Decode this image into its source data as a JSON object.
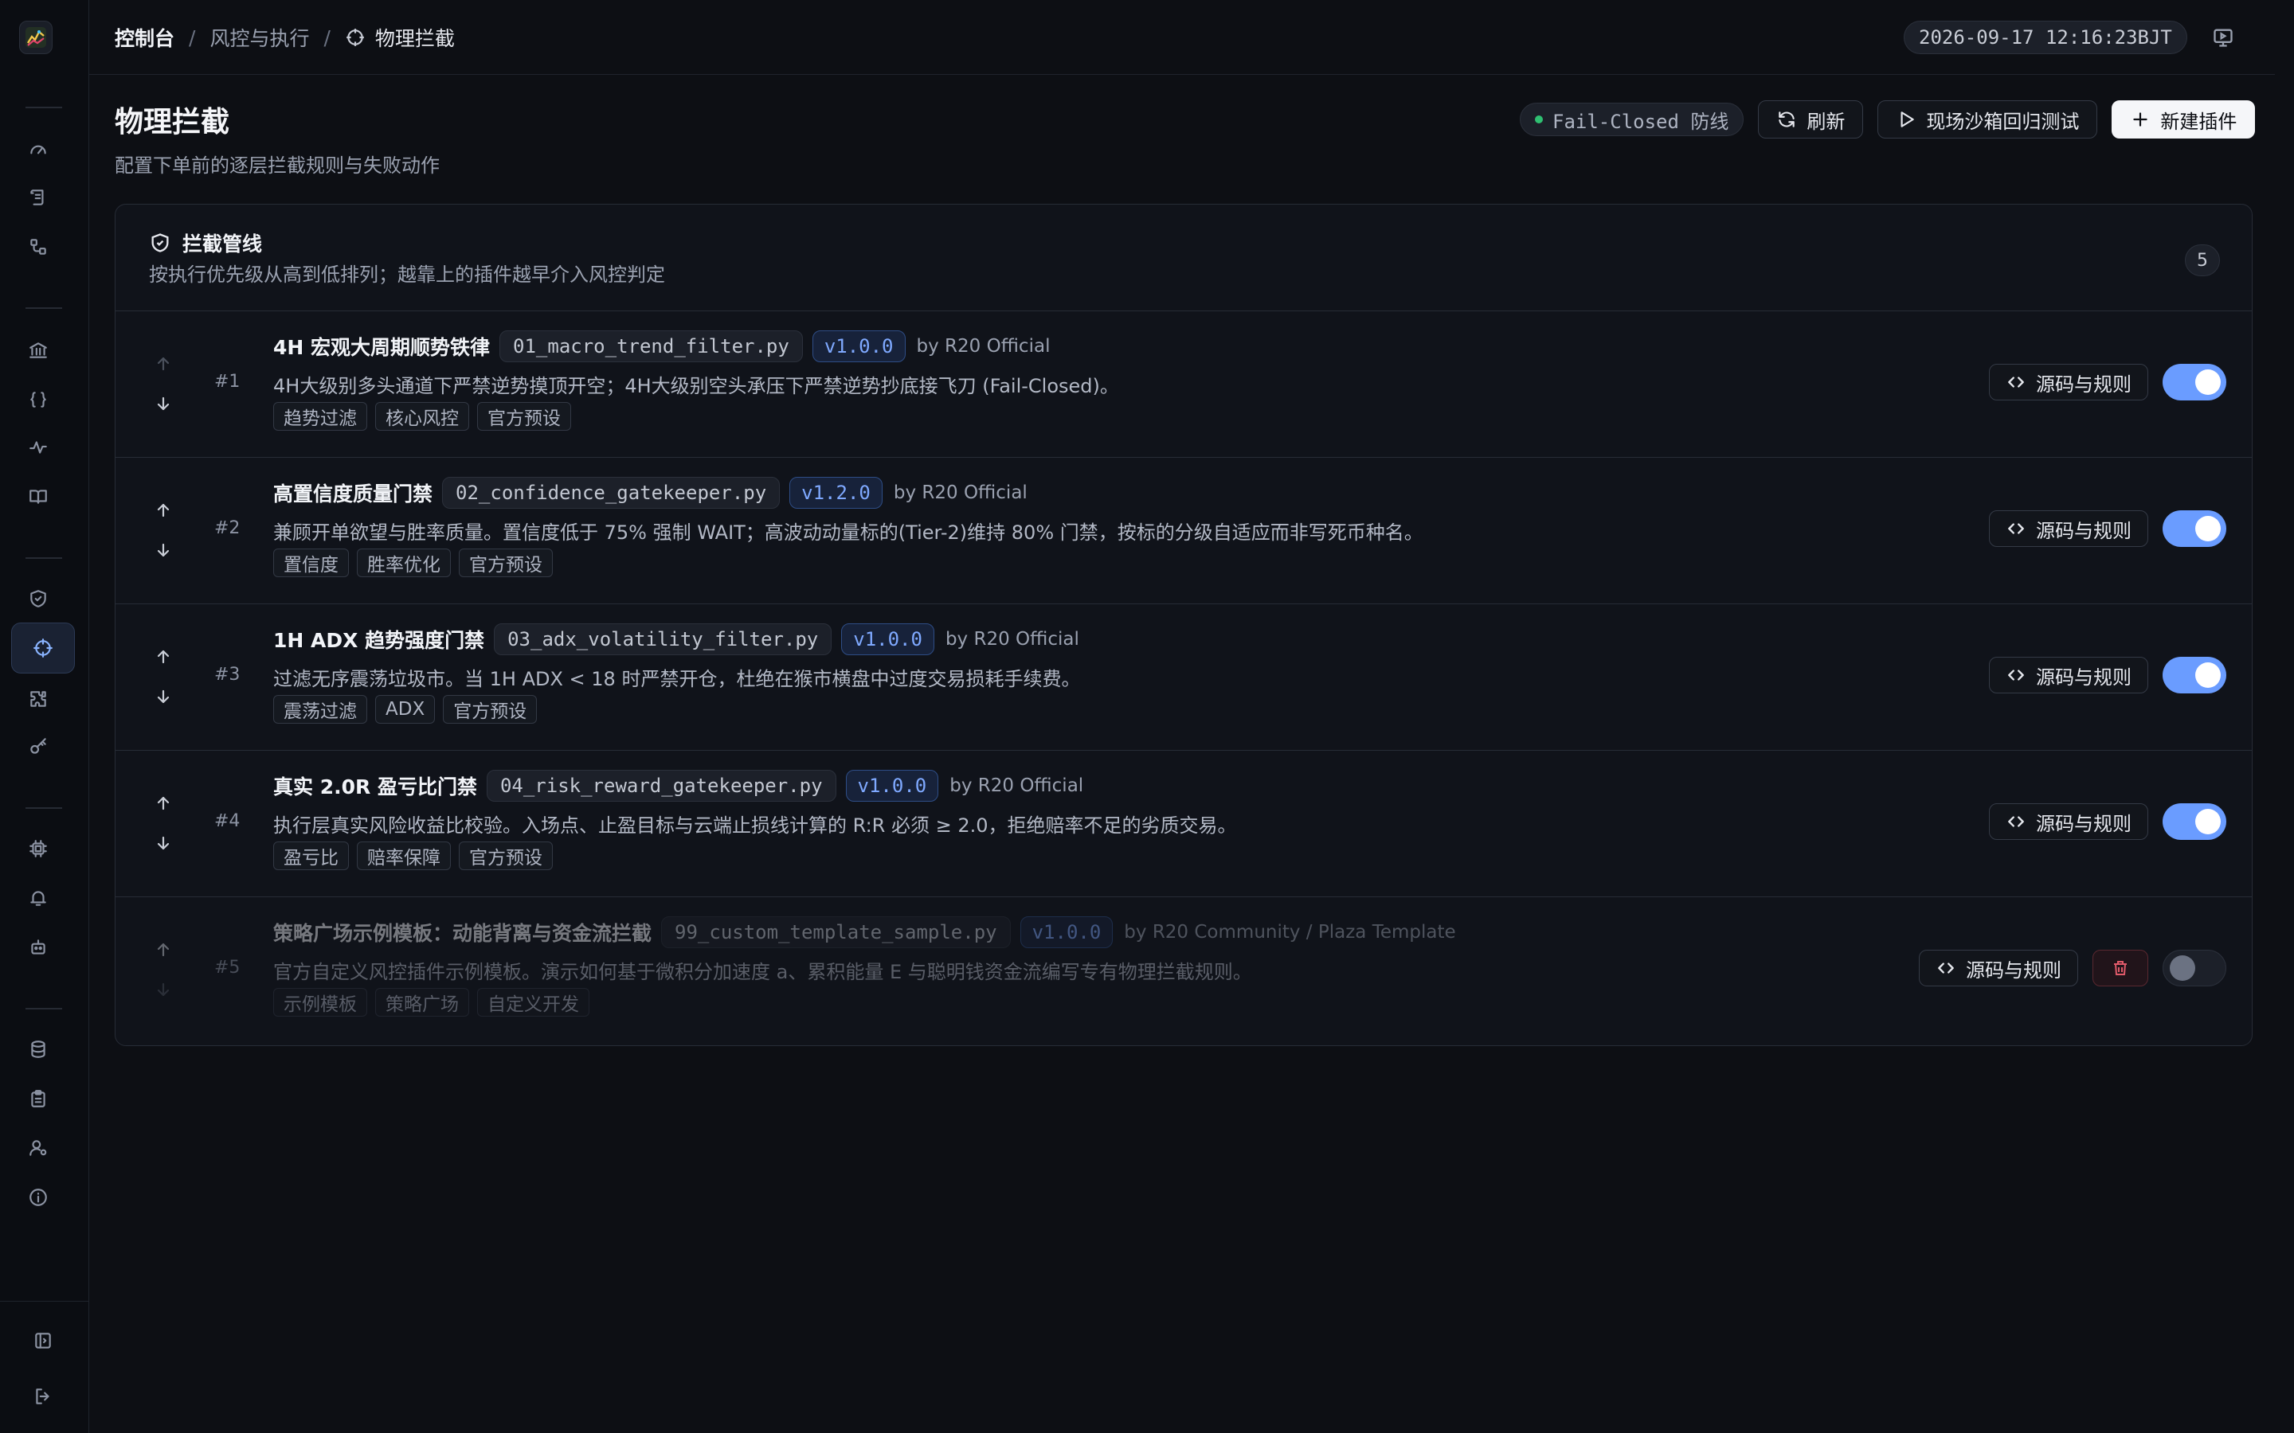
{
  "breadcrumb": {
    "root": "控制台",
    "section": "风控与执行",
    "current": "物理拦截"
  },
  "clock": "2026-09-17 12:16:23BJT",
  "page": {
    "title": "物理拦截",
    "subtitle": "配置下单前的逐层拦截规则与失败动作"
  },
  "actions": {
    "status_label": "Fail-Closed 防线",
    "refresh": "刷新",
    "sandbox": "现场沙箱回归测试",
    "new_plugin": "新建插件"
  },
  "pipeline": {
    "title": "拦截管线",
    "description": "按执行优先级从高到低排列；越靠上的插件越早介入风控判定",
    "count": "5",
    "source_button": "源码与规则",
    "plugins": [
      {
        "rank": "#1",
        "name": "4H 宏观大周期顺势铁律",
        "file": "01_macro_trend_filter.py",
        "version": "v1.0.0",
        "author": "by R20 Official",
        "description": "4H大级别多头通道下严禁逆势摸顶开空；4H大级别空头承压下严禁逆势抄底接飞刀 (Fail-Closed)。",
        "tags": [
          "趋势过滤",
          "核心风控",
          "官方预设"
        ],
        "enabled": true
      },
      {
        "rank": "#2",
        "name": "高置信度质量门禁",
        "file": "02_confidence_gatekeeper.py",
        "version": "v1.2.0",
        "author": "by R20 Official",
        "description": "兼顾开单欲望与胜率质量。置信度低于 75% 强制 WAIT；高波动动量标的(Tier-2)维持 80% 门禁，按标的分级自适应而非写死币种名。",
        "tags": [
          "置信度",
          "胜率优化",
          "官方预设"
        ],
        "enabled": true
      },
      {
        "rank": "#3",
        "name": "1H ADX 趋势强度门禁",
        "file": "03_adx_volatility_filter.py",
        "version": "v1.0.0",
        "author": "by R20 Official",
        "description": "过滤无序震荡垃圾市。当 1H ADX < 18 时严禁开仓，杜绝在猴市横盘中过度交易损耗手续费。",
        "tags": [
          "震荡过滤",
          "ADX",
          "官方预设"
        ],
        "enabled": true
      },
      {
        "rank": "#4",
        "name": "真实 2.0R 盈亏比门禁",
        "file": "04_risk_reward_gatekeeper.py",
        "version": "v1.0.0",
        "author": "by R20 Official",
        "description": "执行层真实风险收益比校验。入场点、止盈目标与云端止损线计算的 R:R 必须 ≥ 2.0，拒绝赔率不足的劣质交易。",
        "tags": [
          "盈亏比",
          "赔率保障",
          "官方预设"
        ],
        "enabled": true
      },
      {
        "rank": "#5",
        "name": "策略广场示例模板：动能背离与资金流拦截",
        "file": "99_custom_template_sample.py",
        "version": "v1.0.0",
        "author": "by R20 Community / Plaza Template",
        "description": "官方自定义风控插件示例模板。演示如何基于微积分加速度 a、累积能量 E 与聪明钱资金流编写专有物理拦截规则。",
        "tags": [
          "示例模板",
          "策略广场",
          "自定义开发"
        ],
        "enabled": false
      }
    ]
  },
  "colors": {
    "accent": "#6a9cff",
    "version": "#7fa9ff",
    "danger": "#e05a6a",
    "status_dot": "#2fbf71"
  }
}
